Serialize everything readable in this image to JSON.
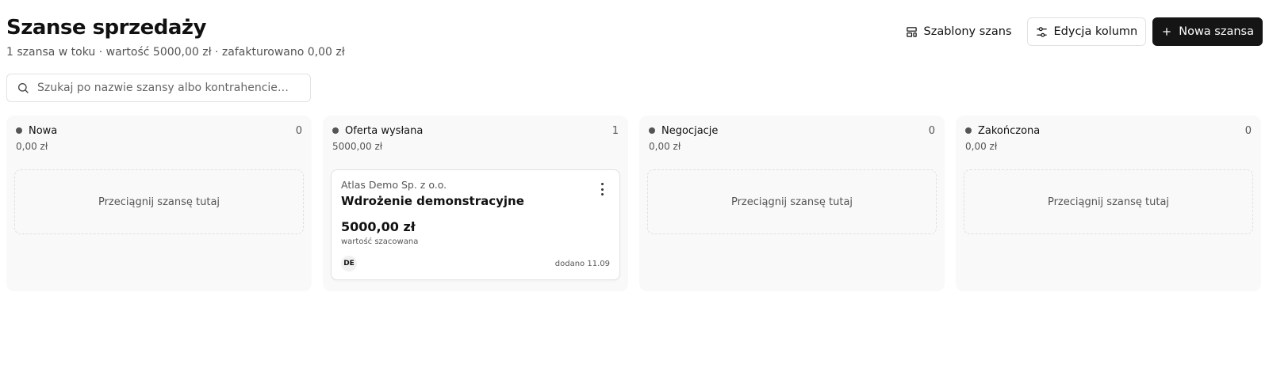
{
  "header": {
    "title": "Szanse sprzedaży",
    "summary": "1 szansa w toku · wartość 5000,00 zł · zafakturowano 0,00 zł"
  },
  "toolbar": {
    "templates_label": "Szablony szans",
    "templates_icon": "layout-template-icon",
    "edit_columns_label": "Edycja kolumn",
    "edit_columns_icon": "sliders-icon",
    "new_label": "Nowa szansa",
    "new_icon": "plus-icon"
  },
  "search": {
    "placeholder": "Szukaj po nazwie szansy albo kontrahencie…",
    "value": "",
    "icon": "search-icon"
  },
  "columns": [
    {
      "name": "Nowa",
      "count": "0",
      "total": "0,00 zł",
      "dropzone": "Przeciągnij szansę tutaj"
    },
    {
      "name": "Oferta wysłana",
      "count": "1",
      "total": "5000,00 zł",
      "card": {
        "company": "Atlas Demo Sp. z o.o.",
        "title": "Wdrożenie demonstracyjne",
        "value": "5000,00 zł",
        "value_label": "wartość szacowana",
        "avatar": "DE",
        "date": "dodano 11.09",
        "menu_icon": "more-vertical-icon"
      }
    },
    {
      "name": "Negocjacje",
      "count": "0",
      "total": "0,00 zł",
      "dropzone": "Przeciągnij szansę tutaj"
    },
    {
      "name": "Zakończona",
      "count": "0",
      "total": "0,00 zł",
      "dropzone": "Przeciągnij szansę tutaj"
    }
  ],
  "colors": {
    "primary": "#151515",
    "column_bg": "#f9f9f9",
    "border": "#e2e2e2",
    "muted_text": "#555555",
    "status_dot": "#555555"
  }
}
